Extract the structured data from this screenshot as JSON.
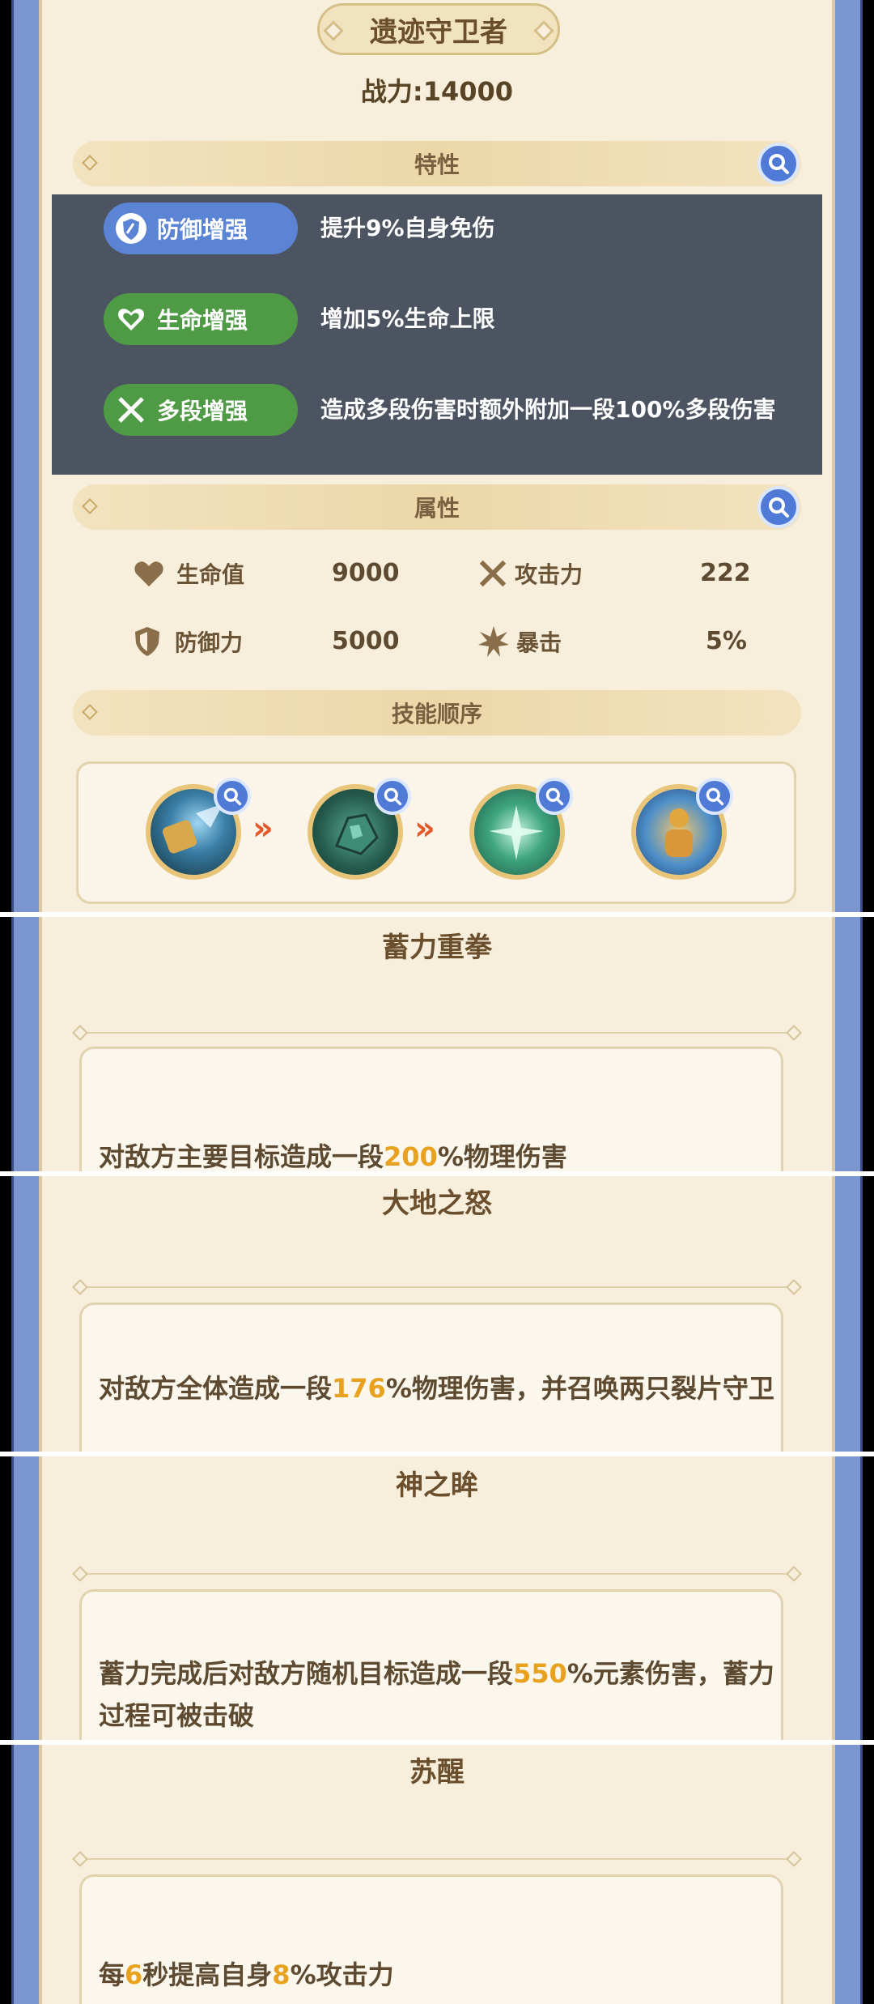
{
  "header": {
    "name": "遗迹守卫者",
    "power": "战力:14000"
  },
  "traits": {
    "section_label": "特性",
    "items": [
      {
        "label": "防御增强",
        "desc": "提升9%自身免伤",
        "color": "#5b84d4",
        "icon": "shield-icon"
      },
      {
        "label": "生命增强",
        "desc": "增加5%生命上限",
        "color": "#4f9a45",
        "icon": "heart-icon"
      },
      {
        "label": "多段增强",
        "desc": "造成多段伤害时额外附加一段100%多段伤害",
        "color": "#4f9a45",
        "icon": "crossed-swords-icon"
      }
    ]
  },
  "attributes": {
    "section_label": "属性",
    "items": [
      {
        "label": "生命值",
        "value": "9000",
        "icon": "heart-icon"
      },
      {
        "label": "攻击力",
        "value": "222",
        "icon": "crossed-swords-icon"
      },
      {
        "label": "防御力",
        "value": "5000",
        "icon": "shield-icon"
      },
      {
        "label": "暴击",
        "value": "5%",
        "icon": "burst-icon"
      }
    ]
  },
  "skill_order": {
    "section_label": "技能顺序",
    "icons": [
      "fist-skill-icon",
      "earth-skill-icon",
      "eye-skill-icon",
      "awaken-skill-icon"
    ],
    "arrow": "»"
  },
  "skills": [
    {
      "name": "蓄力重拳",
      "desc_pre": "对敌方主要目标造成一段",
      "highlight": "200",
      "desc_post": "%物理伤害"
    },
    {
      "name": "大地之怒",
      "desc_pre": "对敌方全体造成一段",
      "highlight": "176",
      "desc_post": "%物理伤害，并召唤两只裂片守卫"
    },
    {
      "name": "神之眸",
      "desc_pre": "蓄力完成后对敌方随机目标造成一段",
      "highlight": "550",
      "desc_post": "%元素伤害，蓄力过程可被击破"
    },
    {
      "name": "苏醒",
      "desc_pre": "每",
      "highlight": "6",
      "desc_mid": "秒提高自身",
      "highlight2": "8",
      "desc_post": "%攻击力"
    }
  ],
  "colors": {
    "accent_blue": "#4f7ad6",
    "trait_blue": "#5b84d4",
    "trait_green": "#4f9a45",
    "highlight": "#e8a21f",
    "arrow": "#e25a2c"
  }
}
